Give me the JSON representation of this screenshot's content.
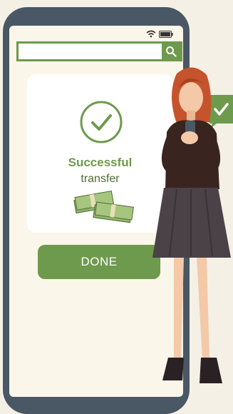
{
  "search": {
    "value": "",
    "placeholder": ""
  },
  "card": {
    "title": "Successful",
    "subtitle": "transfer"
  },
  "button": {
    "label": "DONE"
  },
  "colors": {
    "accent": "#6d9a4c",
    "phone": "#4a5764",
    "background": "#f5f0e6"
  },
  "icons": [
    "wifi-icon",
    "battery-icon",
    "search-icon",
    "checkmark-icon",
    "money-icon"
  ]
}
